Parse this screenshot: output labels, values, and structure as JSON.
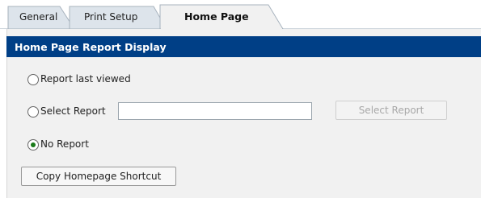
{
  "tabs": [
    {
      "label": "General",
      "active": false
    },
    {
      "label": "Print Setup",
      "active": false
    },
    {
      "label": "Home Page",
      "active": true
    }
  ],
  "section": {
    "title": "Home Page Report Display"
  },
  "options": [
    {
      "label": "Report last viewed",
      "checked": false
    },
    {
      "label": "Select Report",
      "checked": false
    },
    {
      "label": "No Report",
      "checked": true
    }
  ],
  "select_report": {
    "value": "",
    "button_label": "Select Report",
    "button_enabled": false
  },
  "actions": {
    "copy_shortcut_label": "Copy Homepage Shortcut"
  },
  "colors": {
    "header_bg": "#003f86",
    "panel_bg": "#f1f1f1",
    "selected_radio": "#1a7a1a"
  }
}
